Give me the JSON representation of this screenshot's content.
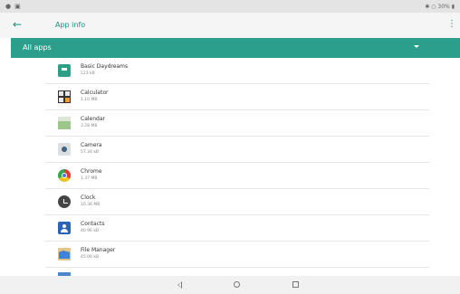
{
  "status_bar": {
    "left_icons": [
      "notification-dot-icon",
      "photo-icon"
    ],
    "right_text": "✱ ○ 30%",
    "right_icons": [
      "bluetooth-icon",
      "alarm-icon",
      "wifi-icon",
      "battery-icon"
    ]
  },
  "app_bar": {
    "back_icon": "back-arrow-icon",
    "title": "App info",
    "more_icon": "more-vertical-icon"
  },
  "filter": {
    "label": "All apps",
    "dropdown_icon": "dropdown-caret-icon",
    "accent_color": "#2c9e8c"
  },
  "apps": [
    {
      "name": "Basic Daydreams",
      "size": "123 kB",
      "icon": "daydreams-icon"
    },
    {
      "name": "Calculator",
      "size": "1.10 MB",
      "icon": "calculator-icon"
    },
    {
      "name": "Calendar",
      "size": "3.28 MB",
      "icon": "calendar-icon"
    },
    {
      "name": "Camera",
      "size": "57.34 kB",
      "icon": "camera-icon"
    },
    {
      "name": "Chrome",
      "size": "1.37 MB",
      "icon": "chrome-icon"
    },
    {
      "name": "Clock",
      "size": "10.38 MB",
      "icon": "clock-icon"
    },
    {
      "name": "Contacts",
      "size": "40.96 kB",
      "icon": "contacts-icon"
    },
    {
      "name": "File Manager",
      "size": "45.06 kB",
      "icon": "file-manager-icon"
    }
  ],
  "nav_bar": {
    "back": "nav-back-icon",
    "home": "nav-home-icon",
    "recents": "nav-recents-icon"
  }
}
